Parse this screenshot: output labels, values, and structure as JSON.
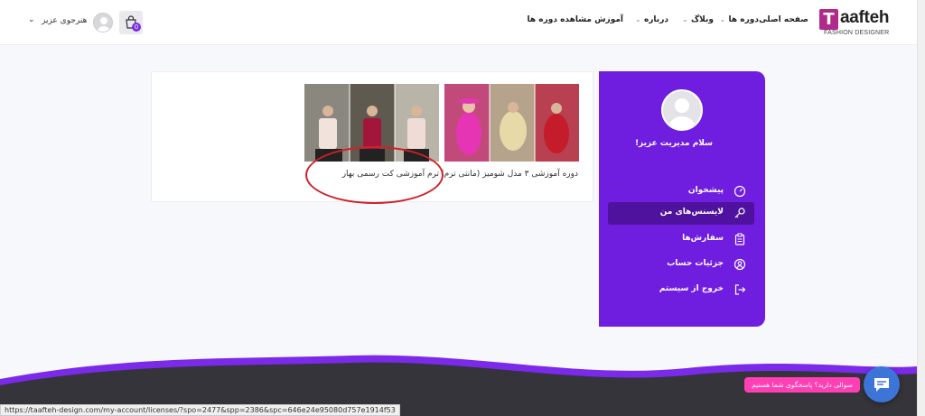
{
  "header": {
    "logo_letter": "T",
    "logo_word": "aafteh",
    "logo_subtitle": "FASHION DESIGNER",
    "nav": [
      {
        "label": "صفحه اصلی"
      },
      {
        "label": "دوره ها"
      },
      {
        "label": "وبلاگ"
      },
      {
        "label": "درباره"
      },
      {
        "label": "آموزش مشاهده دوره ها"
      }
    ],
    "cart_count": "0",
    "user_name": "هنرجوی عزیز",
    "chevron": "⌄"
  },
  "sidebar": {
    "greeting": "سلام مدیریت عزیز!",
    "items": [
      {
        "label": "پیشخوان",
        "icon": "dashboard-icon"
      },
      {
        "label": "لایسنس‌های من",
        "icon": "key-icon",
        "active": true
      },
      {
        "label": "سفارش‌ها",
        "icon": "clipboard-icon"
      },
      {
        "label": "جزئیات حساب",
        "icon": "user-circle-icon"
      },
      {
        "label": "خروج از سیستم",
        "icon": "logout-icon"
      }
    ]
  },
  "licenses": [
    {
      "title": "دوره آموزشی ۳ مدل شومیز (مانتی ترم)"
    },
    {
      "title": "ترم آموزشی کت رسمی بهار"
    }
  ],
  "chat": {
    "prompt": "سوالی دارید؟ پاسخگوی شما هستیم"
  },
  "status_bar": {
    "url": "https://taafteh-design.com/my-account/licenses/?spo=2477&spp=2386&spc=646e24e95080d757e1914f53"
  },
  "colors": {
    "accent": "#6f1ee0",
    "accent_dark": "#4f129e",
    "logo": "#b02a8c",
    "chat": "#3d74d8",
    "chat_bubble": "#ff3fb3",
    "annotation": "#d0202a"
  }
}
